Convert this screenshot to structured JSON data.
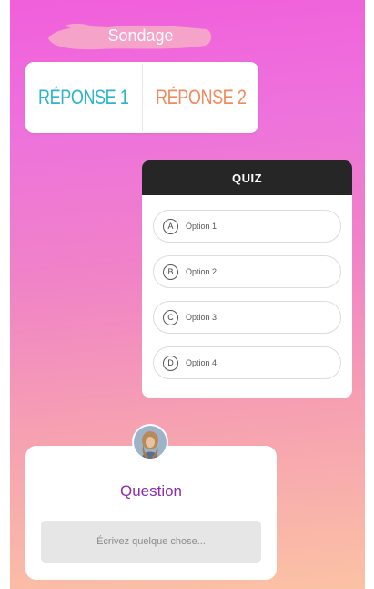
{
  "sondage": {
    "title": "Sondage",
    "options": [
      {
        "label": "RÉPONSE 1",
        "color": "#2bb5c8"
      },
      {
        "label": "RÉPONSE 2",
        "color": "#f08a5d"
      }
    ]
  },
  "quiz": {
    "header": "QUIZ",
    "options": [
      {
        "letter": "A",
        "label": "Option 1"
      },
      {
        "letter": "B",
        "label": "Option 2"
      },
      {
        "letter": "C",
        "label": "Option 3"
      },
      {
        "letter": "D",
        "label": "Option 4"
      }
    ]
  },
  "question": {
    "title": "Question",
    "placeholder": "Écrivez quelque chose...",
    "title_color": "#8a2da8"
  },
  "colors": {
    "background_top": "#f15fdb",
    "background_bottom": "#fbc2a4",
    "brush": "#f6a3c9"
  },
  "avatar": {
    "icon": "user-avatar-icon"
  }
}
